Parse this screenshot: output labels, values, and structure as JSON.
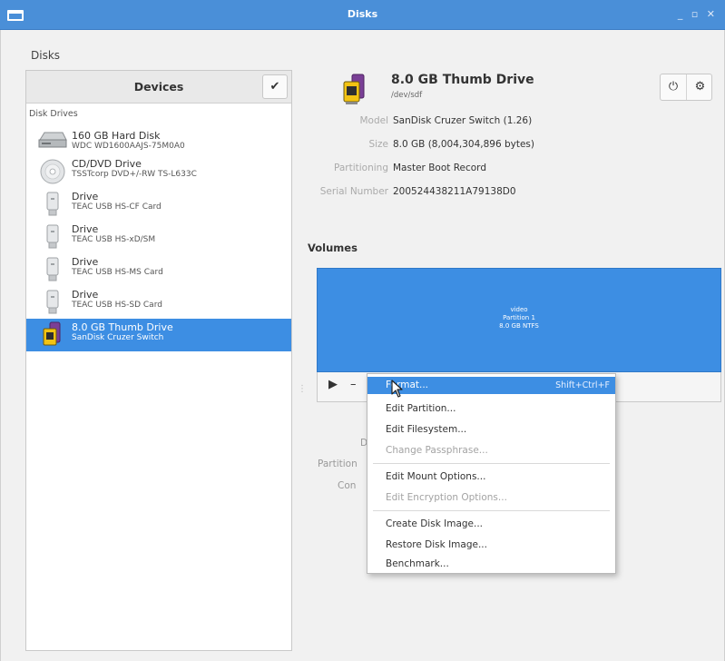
{
  "window": {
    "title": "Disks",
    "controls": "_ ▫ ✕"
  },
  "app_label": "Disks",
  "sidebar": {
    "header": "Devices",
    "check_icon": "checkmark-icon",
    "section": "Disk Drives",
    "devices": [
      {
        "name": "160 GB Hard Disk",
        "sub": "WDC WD1600AAJS-75M0A0",
        "icon": "hard-disk-icon"
      },
      {
        "name": "CD/DVD Drive",
        "sub": "TSSTcorp DVD+/-RW TS-L633C",
        "icon": "optical-disc-icon"
      },
      {
        "name": "Drive",
        "sub": "TEAC USB  HS-CF Card",
        "icon": "usb-drive-icon"
      },
      {
        "name": "Drive",
        "sub": "TEAC USB  HS-xD/SM",
        "icon": "usb-drive-icon"
      },
      {
        "name": "Drive",
        "sub": "TEAC USB  HS-MS Card",
        "icon": "usb-drive-icon"
      },
      {
        "name": "Drive",
        "sub": "TEAC USB  HS-SD Card",
        "icon": "usb-drive-icon"
      },
      {
        "name": "8.0 GB Thumb Drive",
        "sub": "SanDisk Cruzer Switch",
        "icon": "thumb-drive-icon",
        "selected": true
      }
    ]
  },
  "drive": {
    "title": "8.0 GB Thumb Drive",
    "path": "/dev/sdf",
    "power_icon": "power-icon",
    "gear_icon": "gear-icon",
    "props": [
      {
        "key": "Model",
        "value": "SanDisk Cruzer Switch (1.26)"
      },
      {
        "key": "Size",
        "value": "8.0 GB (8,004,304,896 bytes)"
      },
      {
        "key": "Partitioning",
        "value": "Master Boot Record"
      },
      {
        "key": "Serial Number",
        "value": "200524438211A79138D0"
      }
    ]
  },
  "volumes": {
    "heading": "Volumes",
    "partition": {
      "label": "video",
      "name": "Partition 1",
      "size_fs": "8.0 GB NTFS"
    },
    "tools": [
      "play-icon",
      "minus-icon",
      "gears-icon"
    ],
    "partial_labels": [
      "D",
      "Partition",
      "Con"
    ]
  },
  "context_menu": {
    "items": [
      {
        "label": "Format...",
        "accel": "Shift+Ctrl+F",
        "highlighted": true,
        "enabled": true
      },
      {
        "label": "Edit Partition...",
        "enabled": true
      },
      {
        "label": "Edit Filesystem...",
        "enabled": true
      },
      {
        "label": "Change Passphrase...",
        "enabled": false
      },
      {
        "label": "Edit Mount Options...",
        "enabled": true
      },
      {
        "label": "Edit Encryption Options...",
        "enabled": false
      },
      {
        "label": "Create Disk Image...",
        "enabled": true
      },
      {
        "label": "Restore Disk Image...",
        "enabled": true
      },
      {
        "label": "Benchmark...",
        "enabled": true
      }
    ]
  },
  "colors": {
    "accent": "#3d8ee3",
    "titlebar": "#4a8fd8"
  }
}
